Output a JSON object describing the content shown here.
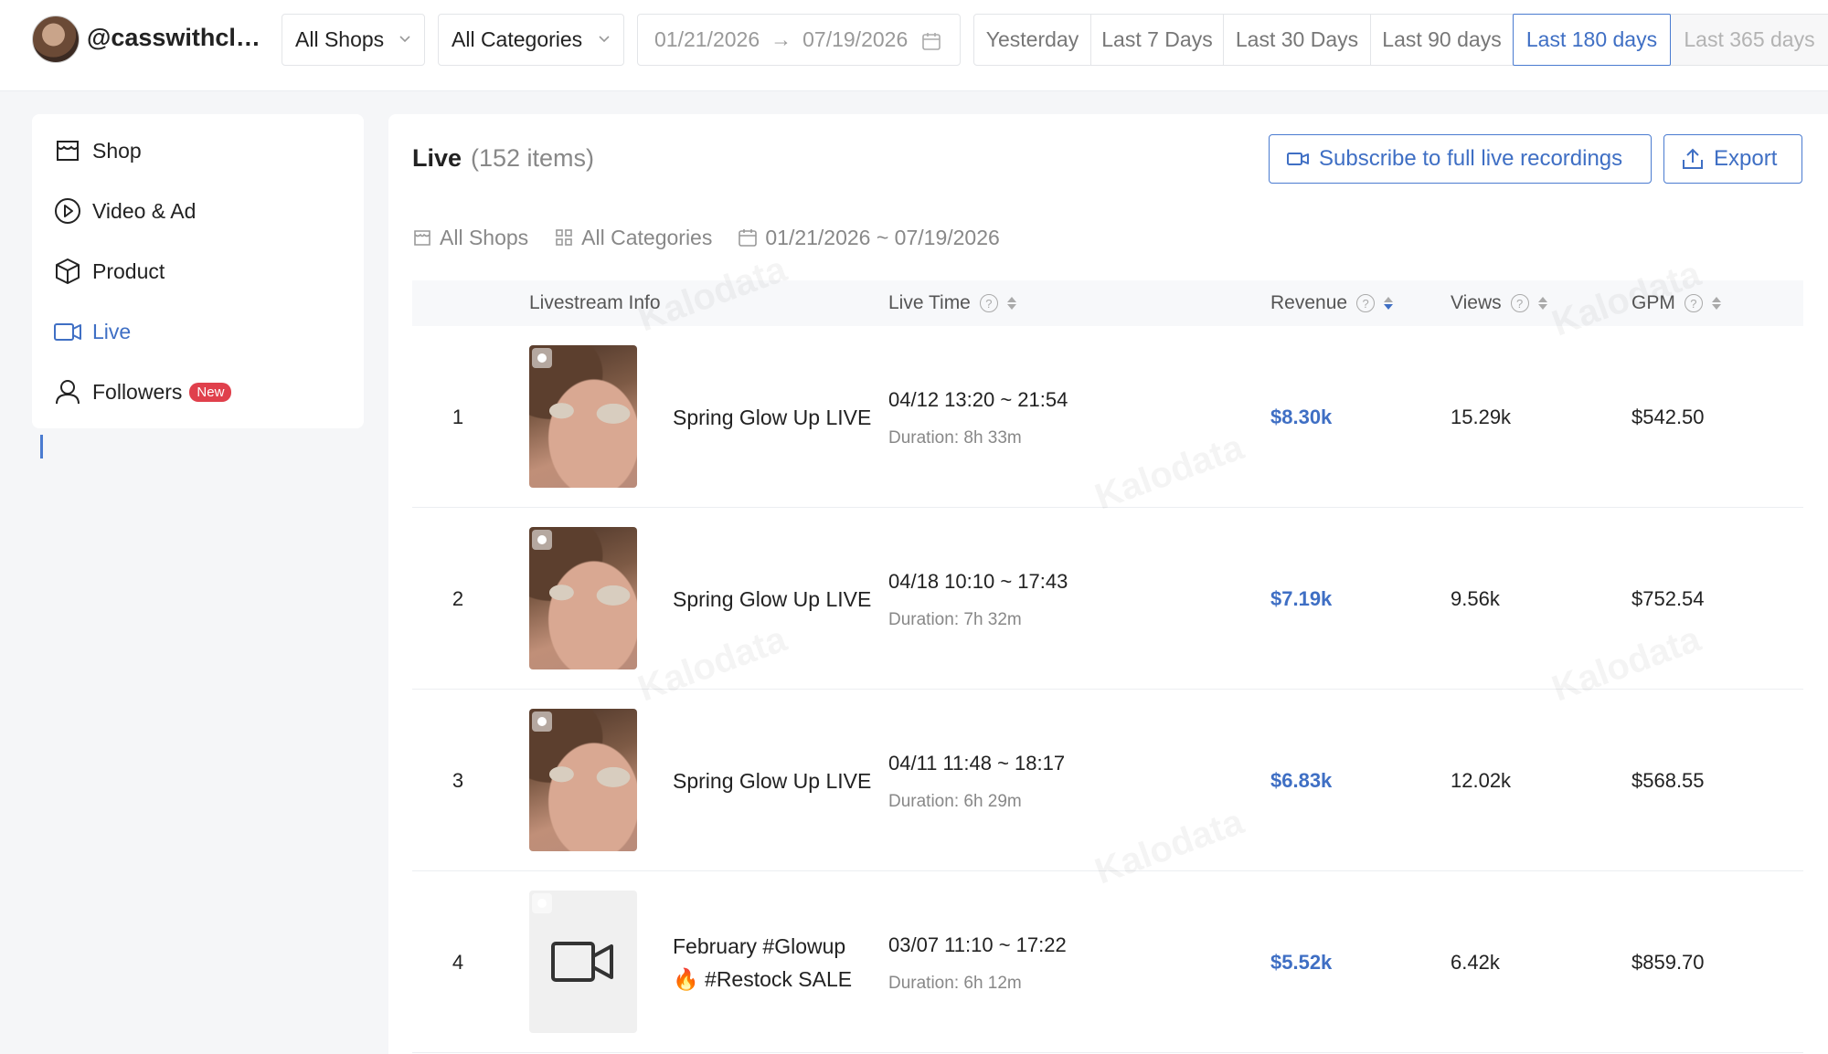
{
  "header": {
    "account_name": "@casswithclas...",
    "shop_filter": "All Shops",
    "category_filter": "All Categories",
    "date_start": "01/21/2026",
    "date_end": "07/19/2026",
    "ranges": [
      "Yesterday",
      "Last 7 Days",
      "Last 30 Days",
      "Last 90 days",
      "Last 180 days",
      "Last 365 days"
    ],
    "active_range": "Last 180 days"
  },
  "sidebar": {
    "items": [
      {
        "label": "Shop",
        "icon": "shop-icon"
      },
      {
        "label": "Video & Ad",
        "icon": "play-circle-icon"
      },
      {
        "label": "Product",
        "icon": "box-icon"
      },
      {
        "label": "Live",
        "icon": "video-camera-icon",
        "active": true
      },
      {
        "label": "Followers",
        "icon": "user-icon",
        "badge": "New"
      }
    ]
  },
  "main": {
    "title": "Live",
    "count": "(152 items)",
    "subscribe_label": "Subscribe to full live recordings",
    "export_label": "Export",
    "filters": {
      "shops": "All Shops",
      "categories": "All Categories",
      "date_range": "01/21/2026 ~ 07/19/2026"
    },
    "columns": {
      "info": "Livestream Info",
      "live_time": "Live Time",
      "revenue": "Revenue",
      "views": "Views",
      "gpm": "GPM"
    },
    "rows": [
      {
        "rank": "1",
        "title": "Spring Glow Up LIVE",
        "time": "04/12 13:20 ~ 21:54",
        "duration": "Duration: 8h 33m",
        "revenue": "$8.30k",
        "views": "15.29k",
        "gpm": "$542.50",
        "thumb": "photo"
      },
      {
        "rank": "2",
        "title": "Spring Glow Up LIVE",
        "time": "04/18 10:10 ~ 17:43",
        "duration": "Duration: 7h 32m",
        "revenue": "$7.19k",
        "views": "9.56k",
        "gpm": "$752.54",
        "thumb": "photo"
      },
      {
        "rank": "3",
        "title": "Spring Glow Up LIVE",
        "time": "04/11 11:48 ~ 18:17",
        "duration": "Duration: 6h 29m",
        "revenue": "$6.83k",
        "views": "12.02k",
        "gpm": "$568.55",
        "thumb": "photo"
      },
      {
        "rank": "4",
        "title": "February #Glowup 🔥 #Restock SALE",
        "time": "03/07 11:10 ~ 17:22",
        "duration": "Duration: 6h 12m",
        "revenue": "$5.52k",
        "views": "6.42k",
        "gpm": "$859.70",
        "thumb": "placeholder"
      }
    ]
  },
  "colors": {
    "accent": "#3f6fc4",
    "badge": "#e0404c"
  },
  "watermark": "Kalodata"
}
